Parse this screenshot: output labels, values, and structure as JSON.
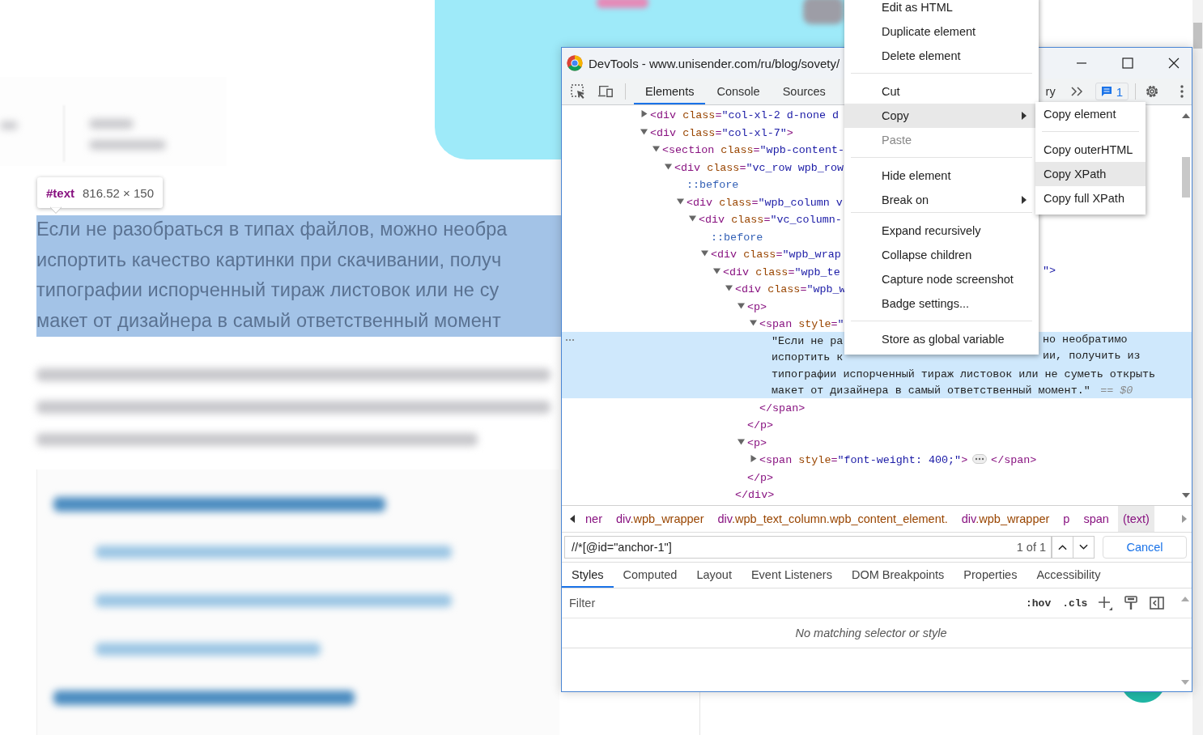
{
  "page": {
    "tooltip": {
      "node": "#text",
      "size": "816.52 × 150"
    },
    "paragraph_lines": [
      "Если не разобраться в типах файлов, можно необра",
      "испортить качество картинки при скачивании, получ",
      "типографии испорченный тираж листовок или не су",
      "макет от дизайнера в самый ответственный момент"
    ]
  },
  "devtools": {
    "title": "DevTools - www.unisender.com/ru/blog/sovety/",
    "tabs": [
      {
        "label": "Elements",
        "selected": true
      },
      {
        "label": "Console",
        "selected": false
      },
      {
        "label": "Sources",
        "selected": false
      }
    ],
    "cut_tab": "ry",
    "issues_count": "1",
    "elements": {
      "nodes": [
        {
          "kind": "element",
          "open": "<div class=\"col-xl-2 d-none d",
          "expanded": false
        },
        {
          "kind": "element",
          "open": "<div class=\"col-xl-7\">",
          "expanded": true,
          "children": [
            {
              "kind": "element",
              "open": "<section class=\"wpb-content-",
              "expanded": true,
              "children": [
                {
                  "kind": "element",
                  "open": "<div class=\"vc_row wpb_row",
                  "expanded": true,
                  "children": [
                    {
                      "kind": "pseudo",
                      "label": "::before"
                    },
                    {
                      "kind": "element",
                      "open": "<div class=\"wpb_column v",
                      "expanded": true,
                      "children": [
                        {
                          "kind": "element",
                          "open": "<div class=\"vc_column-",
                          "expanded": true,
                          "children": [
                            {
                              "kind": "pseudo",
                              "label": "::before"
                            },
                            {
                              "kind": "element",
                              "open": "<div class=\"wpb_wrap",
                              "expanded": true,
                              "children": [
                                {
                                  "kind": "element",
                                  "open": "<div class=\"wpb_te",
                                  "open_right": "\">",
                                  "expanded": true,
                                  "children": [
                                    {
                                      "kind": "element",
                                      "open": "<div class=\"wpb_w",
                                      "expanded": true,
                                      "close": "</div>",
                                      "children": [
                                        {
                                          "kind": "element",
                                          "open": "<p>",
                                          "expanded": true,
                                          "close": "</p>",
                                          "children": [
                                            {
                                              "kind": "element",
                                              "open": "<span style=\"",
                                              "expanded": true,
                                              "close": "</span>",
                                              "children": [
                                                {
                                                  "kind": "text",
                                                  "selected": true,
                                                  "suffix": "== $0",
                                                  "lines": [
                                                    {
                                                      "left": "\"Если не ра",
                                                      "right": "но необратимо"
                                                    },
                                                    {
                                                      "left": "испортить к",
                                                      "right": "ии, получить из"
                                                    },
                                                    {
                                                      "left": "типографии испорченный тираж листовок или не суметь открыть"
                                                    },
                                                    {
                                                      "left": "макет от дизайнера в самый ответственный момент.\""
                                                    }
                                                  ]
                                                }
                                              ]
                                            }
                                          ]
                                        },
                                        {
                                          "kind": "element",
                                          "open": "<p>",
                                          "expanded": true,
                                          "close": "</p>",
                                          "children": [
                                            {
                                              "kind": "element",
                                              "open": "<span style=\"font-weight: 400;\">",
                                              "expanded": false,
                                              "close": "</span>"
                                            }
                                          ]
                                        }
                                      ]
                                    }
                                  ]
                                }
                              ]
                            }
                          ]
                        }
                      ]
                    }
                  ]
                }
              ]
            }
          ]
        }
      ]
    },
    "breadcrumbs": [
      {
        "label": "ner",
        "selected": false
      },
      {
        "label": "div.wpb_wrapper",
        "selected": false
      },
      {
        "label": "div.wpb_text_column.wpb_content_element.",
        "selected": false
      },
      {
        "label": "div.wpb_wrapper",
        "selected": false
      },
      {
        "label": "p",
        "selected": false
      },
      {
        "label": "span",
        "selected": false
      },
      {
        "label": "(text)",
        "selected": true
      }
    ],
    "search": {
      "value": "//*[@id=\"anchor-1\"]",
      "count": "1 of 1",
      "cancel": "Cancel"
    },
    "subtabs": [
      {
        "label": "Styles",
        "selected": true
      },
      {
        "label": "Computed",
        "selected": false
      },
      {
        "label": "Layout",
        "selected": false
      },
      {
        "label": "Event Listeners",
        "selected": false
      },
      {
        "label": "DOM Breakpoints",
        "selected": false
      },
      {
        "label": "Properties",
        "selected": false
      },
      {
        "label": "Accessibility",
        "selected": false
      }
    ],
    "filter": {
      "placeholder": "Filter",
      "hov": ":hov",
      "cls": ".cls"
    },
    "styles_message": "No matching selector or style"
  },
  "context_menu": {
    "groups": [
      [
        {
          "label": "Edit as HTML",
          "highlighted": false,
          "disabled": false,
          "submenu": false
        },
        {
          "label": "Duplicate element",
          "highlighted": false,
          "disabled": false,
          "submenu": false
        },
        {
          "label": "Delete element",
          "highlighted": false,
          "disabled": false,
          "submenu": false
        }
      ],
      [
        {
          "label": "Cut",
          "highlighted": false,
          "disabled": false,
          "submenu": false
        },
        {
          "label": "Copy",
          "highlighted": true,
          "disabled": false,
          "submenu": true
        },
        {
          "label": "Paste",
          "highlighted": false,
          "disabled": true,
          "submenu": false
        }
      ],
      [
        {
          "label": "Hide element",
          "highlighted": false,
          "disabled": false,
          "submenu": false
        },
        {
          "label": "Break on",
          "highlighted": false,
          "disabled": false,
          "submenu": true
        }
      ],
      [
        {
          "label": "Expand recursively",
          "highlighted": false,
          "disabled": false,
          "submenu": false
        },
        {
          "label": "Collapse children",
          "highlighted": false,
          "disabled": false,
          "submenu": false
        },
        {
          "label": "Capture node screenshot",
          "highlighted": false,
          "disabled": false,
          "submenu": false
        },
        {
          "label": "Badge settings...",
          "highlighted": false,
          "disabled": false,
          "submenu": false
        }
      ],
      [
        {
          "label": "Store as global variable",
          "highlighted": false,
          "disabled": false,
          "submenu": false
        }
      ]
    ],
    "copy_submenu": [
      [
        {
          "label": "Copy element",
          "highlighted": false
        }
      ],
      [
        {
          "label": "Copy outerHTML",
          "highlighted": false
        },
        {
          "label": "Copy XPath",
          "highlighted": true
        },
        {
          "label": "Copy full XPath",
          "highlighted": false
        }
      ]
    ]
  }
}
